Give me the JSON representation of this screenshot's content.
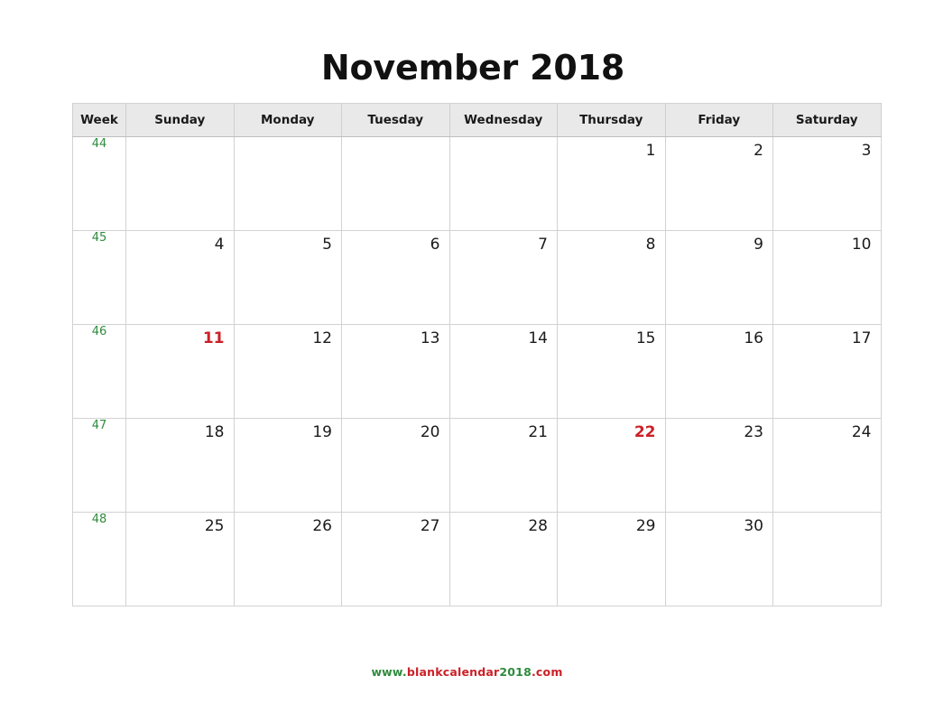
{
  "title": "November 2018",
  "table": {
    "headers": [
      "Week",
      "Sunday",
      "Monday",
      "Tuesday",
      "Wednesday",
      "Thursday",
      "Friday",
      "Saturday"
    ],
    "rows": [
      {
        "week": "44",
        "days": [
          "",
          "",
          "",
          "",
          "1",
          "2",
          "3"
        ]
      },
      {
        "week": "45",
        "days": [
          "4",
          "5",
          "6",
          "7",
          "8",
          "9",
          "10"
        ]
      },
      {
        "week": "46",
        "days": [
          "11",
          "12",
          "13",
          "14",
          "15",
          "16",
          "17"
        ]
      },
      {
        "week": "47",
        "days": [
          "18",
          "19",
          "20",
          "21",
          "22",
          "23",
          "24"
        ]
      },
      {
        "week": "48",
        "days": [
          "25",
          "26",
          "27",
          "28",
          "29",
          "30",
          ""
        ]
      }
    ],
    "highlighted_days": [
      "11",
      "22"
    ]
  },
  "footer": {
    "segments": [
      {
        "text": "www.",
        "color": "#2e8b3c"
      },
      {
        "text": "blankcalendar",
        "color": "#cc2027"
      },
      {
        "text": "2018",
        "color": "#2e8b3c"
      },
      {
        "text": ".com",
        "color": "#cc2027"
      }
    ],
    "full_text": "www.blankcalendar2018.com"
  },
  "colors": {
    "header_background": "#e9e9e9",
    "border": "#d2d2d2",
    "week_number": "#2e8b3c",
    "day_number": "#1a1a1a",
    "holiday": "#cc2027",
    "page_background": "#ffffff"
  }
}
